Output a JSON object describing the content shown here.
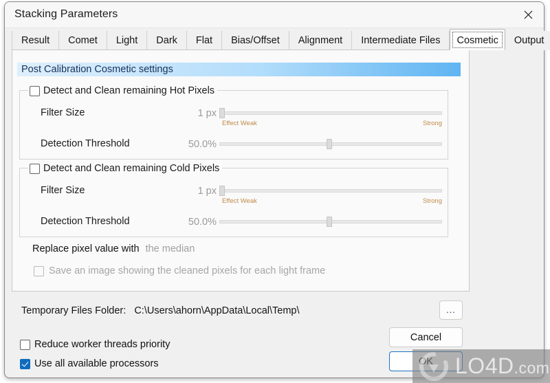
{
  "window": {
    "title": "Stacking Parameters",
    "close_icon": "close-icon"
  },
  "tabs": [
    {
      "label": "Result",
      "selected": false
    },
    {
      "label": "Comet",
      "selected": false
    },
    {
      "label": "Light",
      "selected": false
    },
    {
      "label": "Dark",
      "selected": false
    },
    {
      "label": "Flat",
      "selected": false
    },
    {
      "label": "Bias/Offset",
      "selected": false
    },
    {
      "label": "Alignment",
      "selected": false
    },
    {
      "label": "Intermediate Files",
      "selected": false
    },
    {
      "label": "Cosmetic",
      "selected": true
    },
    {
      "label": "Output",
      "selected": false
    }
  ],
  "cosmetic": {
    "section_title": "Post Calibration Cosmetic settings",
    "hot": {
      "enabled_label": "Detect and Clean remaining Hot Pixels",
      "enabled": false,
      "filter_size_label": "Filter Size",
      "filter_size_value": "1 px",
      "filter_size_percent": 1,
      "scale_weak": "Effect Weak",
      "scale_strong": "Strong",
      "threshold_label": "Detection Threshold",
      "threshold_value": "50.0%",
      "threshold_percent": 50
    },
    "cold": {
      "enabled_label": "Detect and Clean remaining Cold Pixels",
      "enabled": false,
      "filter_size_label": "Filter Size",
      "filter_size_value": "1 px",
      "filter_size_percent": 1,
      "scale_weak": "Effect Weak",
      "scale_strong": "Strong",
      "threshold_label": "Detection Threshold",
      "threshold_value": "50.0%",
      "threshold_percent": 50
    },
    "replace_label": "Replace pixel value with",
    "replace_value": "the median",
    "save_cleaned_label": "Save an image showing the cleaned pixels for each light frame",
    "save_cleaned_checked": false
  },
  "footer": {
    "temp_label": "Temporary Files Folder:",
    "temp_path": "C:\\Users\\ahorn\\AppData\\Local\\Temp\\",
    "browse_label": "...",
    "cancel_label": "Cancel",
    "ok_label": "OK",
    "reduce_priority_label": "Reduce worker threads priority",
    "reduce_priority_checked": false,
    "use_all_processors_label": "Use all available processors",
    "use_all_processors_checked": true
  },
  "watermark": {
    "main": "LO4D",
    "suffix": ".com"
  },
  "colors": {
    "accent": "#0f6cbd",
    "header_gradient_start": "#dfeffc",
    "header_gradient_end": "#5fb4f2",
    "scale_label": "#c08a4a",
    "disabled_text": "#a0a0a0"
  }
}
